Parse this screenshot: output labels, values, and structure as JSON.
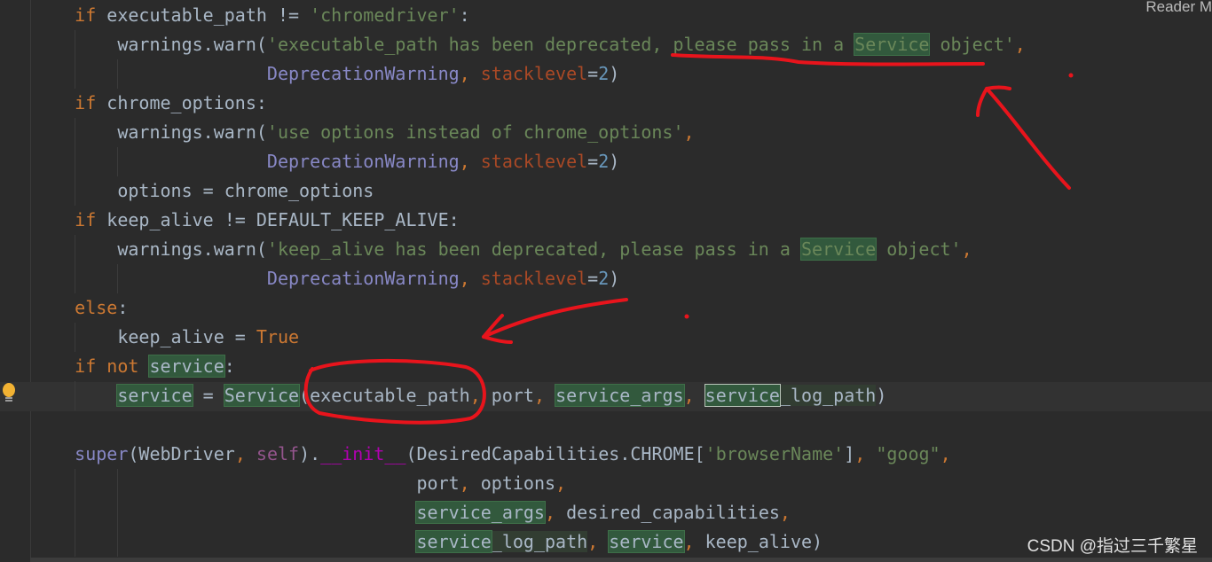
{
  "header": {
    "reader_mode": "Reader M"
  },
  "watermark": "CSDN @指过三千繁星",
  "colors": {
    "background": "#2b2b2b",
    "keyword": "#cc7832",
    "string": "#6a8759",
    "builtin": "#8888c6",
    "param": "#aa4926",
    "number": "#6897bb",
    "annotation": "#e8141c",
    "highlight": "#32593d"
  },
  "icons": {
    "gutter": "lightbulb-icon"
  },
  "code_lines": [
    {
      "indent": 4,
      "tokens": [
        [
          "if ",
          "kw"
        ],
        [
          "executable_path != ",
          "id"
        ],
        [
          "'chromedriver'",
          "str"
        ],
        [
          ":",
          "id"
        ]
      ]
    },
    {
      "indent": 8,
      "tokens": [
        [
          "warnings.warn(",
          "id"
        ],
        [
          "'executable_path has been deprecated, please pass in a ",
          "str"
        ],
        [
          "Service",
          "str hl"
        ],
        [
          " object'",
          "str"
        ],
        [
          ",",
          "pn"
        ]
      ]
    },
    {
      "indent": 22,
      "tokens": [
        [
          "DeprecationWarning",
          "bi"
        ],
        [
          ", ",
          "pn"
        ],
        [
          "stacklevel",
          "prm"
        ],
        [
          "=",
          "id"
        ],
        [
          "2",
          "num"
        ],
        [
          ")",
          "id"
        ]
      ]
    },
    {
      "indent": 4,
      "tokens": [
        [
          "if ",
          "kw"
        ],
        [
          "chrome_options:",
          "id"
        ]
      ]
    },
    {
      "indent": 8,
      "tokens": [
        [
          "warnings.warn(",
          "id"
        ],
        [
          "'use options instead of chrome_options'",
          "str"
        ],
        [
          ",",
          "pn"
        ]
      ]
    },
    {
      "indent": 22,
      "tokens": [
        [
          "DeprecationWarning",
          "bi"
        ],
        [
          ", ",
          "pn"
        ],
        [
          "stacklevel",
          "prm"
        ],
        [
          "=",
          "id"
        ],
        [
          "2",
          "num"
        ],
        [
          ")",
          "id"
        ]
      ]
    },
    {
      "indent": 8,
      "tokens": [
        [
          "options = chrome_options",
          "id"
        ]
      ]
    },
    {
      "indent": 4,
      "tokens": [
        [
          "if ",
          "kw"
        ],
        [
          "keep_alive != DEFAULT_KEEP_ALIVE:",
          "id"
        ]
      ]
    },
    {
      "indent": 8,
      "tokens": [
        [
          "warnings.warn(",
          "id"
        ],
        [
          "'keep_alive has been deprecated, please pass in a ",
          "str"
        ],
        [
          "Service",
          "str hl"
        ],
        [
          " object'",
          "str"
        ],
        [
          ",",
          "pn"
        ]
      ]
    },
    {
      "indent": 22,
      "tokens": [
        [
          "DeprecationWarning",
          "bi"
        ],
        [
          ", ",
          "pn"
        ],
        [
          "stacklevel",
          "prm"
        ],
        [
          "=",
          "id"
        ],
        [
          "2",
          "num"
        ],
        [
          ")",
          "id"
        ]
      ]
    },
    {
      "indent": 4,
      "tokens": [
        [
          "else",
          "kw"
        ],
        [
          ":",
          "id"
        ]
      ]
    },
    {
      "indent": 8,
      "tokens": [
        [
          "keep_alive = ",
          "id"
        ],
        [
          "True",
          "kw"
        ]
      ]
    },
    {
      "indent": 4,
      "tokens": [
        [
          "if not ",
          "kw"
        ],
        [
          "service",
          "id hl"
        ],
        [
          ":",
          "id"
        ]
      ]
    },
    {
      "indent": 8,
      "tokens": [
        [
          "service",
          "id hl"
        ],
        [
          " = ",
          "id"
        ],
        [
          "Service",
          "id hl"
        ],
        [
          "(executable_path",
          "id"
        ],
        [
          ", ",
          "pn"
        ],
        [
          "port",
          "id"
        ],
        [
          ", ",
          "pn"
        ],
        [
          "service_args",
          "id hl"
        ],
        [
          ", ",
          "pn"
        ],
        [
          "service",
          "id hlb"
        ],
        [
          "_log_path",
          "id hld"
        ],
        [
          ")",
          "id"
        ]
      ]
    },
    {
      "indent": 0,
      "tokens": []
    },
    {
      "indent": 4,
      "tokens": [
        [
          "super",
          "bi"
        ],
        [
          "(WebDriver",
          "id"
        ],
        [
          ", ",
          "pn"
        ],
        [
          "self",
          "slf"
        ],
        [
          ").",
          "id"
        ],
        [
          "__init__",
          "mg"
        ],
        [
          "(DesiredCapabilities.CHROME[",
          "id"
        ],
        [
          "'browserName'",
          "str"
        ],
        [
          "]",
          "id"
        ],
        [
          ", ",
          "pn"
        ],
        [
          "\"goog\"",
          "str"
        ],
        [
          ",",
          "pn"
        ]
      ]
    },
    {
      "indent": 36,
      "tokens": [
        [
          "port",
          "id"
        ],
        [
          ", ",
          "pn"
        ],
        [
          "options",
          "id"
        ],
        [
          ",",
          "pn"
        ]
      ]
    },
    {
      "indent": 36,
      "tokens": [
        [
          "service_args",
          "id hl"
        ],
        [
          ", ",
          "pn"
        ],
        [
          "desired_capabilities",
          "id"
        ],
        [
          ",",
          "pn"
        ]
      ]
    },
    {
      "indent": 36,
      "tokens": [
        [
          "service",
          "id hl"
        ],
        [
          "_log_path",
          "id hld"
        ],
        [
          ", ",
          "pn"
        ],
        [
          "service",
          "id hl"
        ],
        [
          ", ",
          "pn"
        ],
        [
          "keep_alive)",
          "id"
        ]
      ]
    }
  ]
}
